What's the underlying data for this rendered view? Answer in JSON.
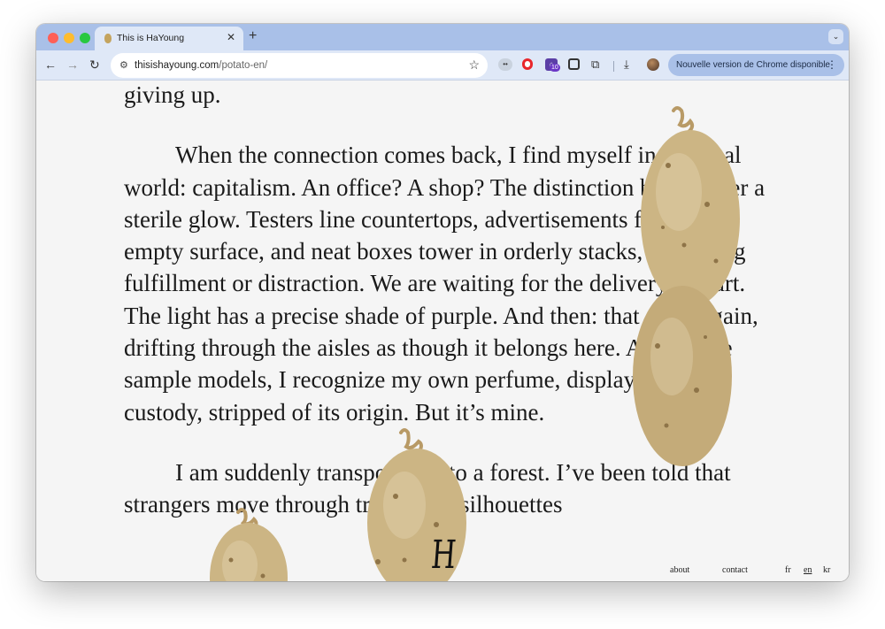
{
  "browser": {
    "tab": {
      "title": "This is HaYoung",
      "close_glyph": "✕"
    },
    "new_tab_glyph": "+",
    "tab_menu_glyph": "⌄",
    "nav": {
      "back_glyph": "←",
      "forward_glyph": "→",
      "reload_glyph": "↻"
    },
    "address_bar": {
      "site_info_glyph": "⚙",
      "domain": "thisishayoung.com",
      "path": "/potato-en/",
      "bookmark_glyph": "☆"
    },
    "extensions": [
      {
        "name": "eyes-extension-icon",
        "glyph": "••"
      },
      {
        "name": "opera-extension-icon",
        "glyph": ""
      },
      {
        "name": "house-extension-icon",
        "glyph": "⌂",
        "badge": "10"
      },
      {
        "name": "square-extension-icon",
        "glyph": ""
      },
      {
        "name": "puzzle-extension-icon",
        "glyph": "⧉"
      }
    ],
    "download_glyph": "⤓",
    "update_button": {
      "label": "Nouvelle version de Chrome disponible",
      "menu_glyph": "⋮"
    }
  },
  "page": {
    "paragraphs": [
      {
        "text": "giving up.",
        "indent": false
      },
      {
        "text": "When the connection comes back, I find myself in an usual world: capitalism. An office? A shop? The distinction blurs under a sterile glow. Testers line countertops, advertisements fill every empty surface, and neat boxes tower in orderly stacks, promising fulfillment or distraction. We are waiting for the delivery to start. The light has a precise shade of purple. And then: that scent again, drifting through the aisles as though it belongs here. Among the sample models, I recognize my own perfume, displayed like a custody, stripped of its origin. But it’s mine.",
        "indent": true
      },
      {
        "text": "I am suddenly transported into a forest. I’ve been told that strangers move through trees. Two silhouettes",
        "indent": true
      }
    ],
    "logo_letter": "H",
    "footer": {
      "about": "about",
      "contact": "contact",
      "lang_fr": "fr",
      "lang_en": "en",
      "lang_kr": "kr"
    }
  },
  "colors": {
    "tabstrip": "#a9c0e8",
    "toolbar": "#dfe8f7",
    "page_background": "#f5f5f5",
    "text": "#1a1a1a",
    "potato_skin": "#c9b27e"
  }
}
